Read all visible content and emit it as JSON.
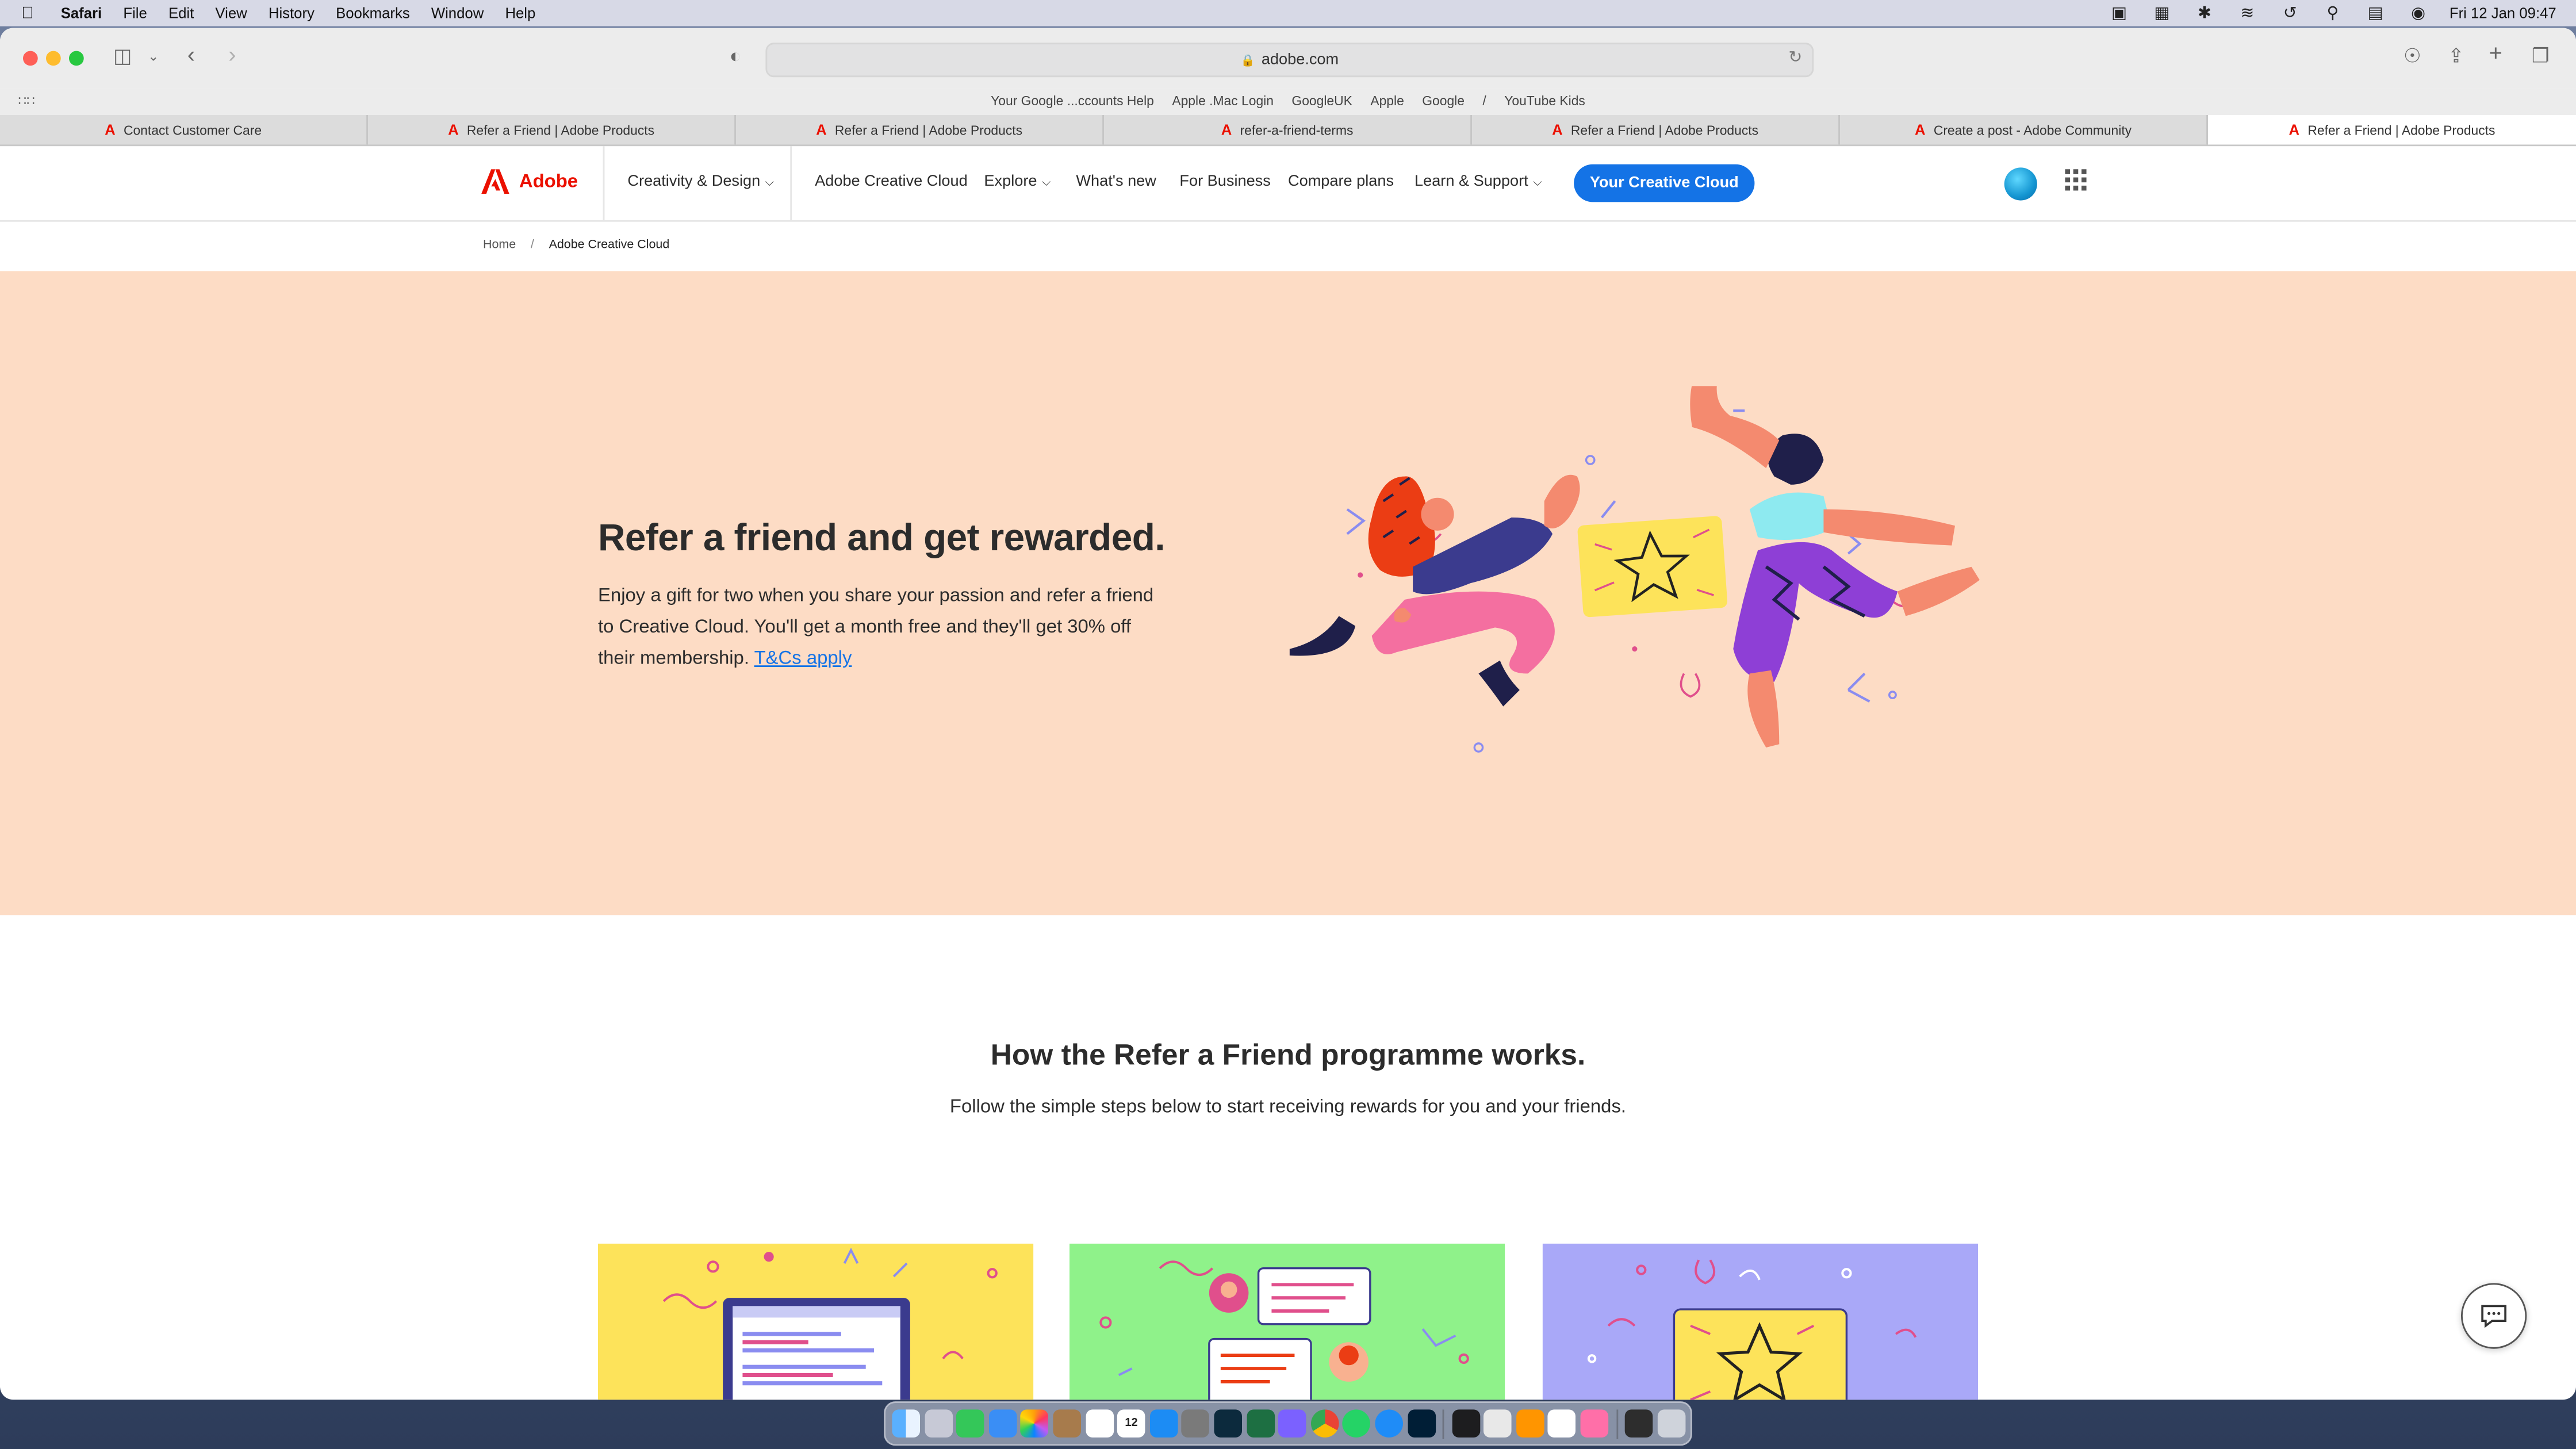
{
  "menubar": {
    "items": [
      "Safari",
      "File",
      "Edit",
      "View",
      "History",
      "Bookmarks",
      "Window",
      "Help"
    ],
    "status_icons": [
      "display-icon",
      "control-center-icon",
      "bluetooth-icon",
      "wifi-icon",
      "time-machine-icon",
      "spotlight-icon",
      "control-switch-icon",
      "siri-icon"
    ],
    "clock": "Fri 12 Jan  09:47"
  },
  "browser": {
    "url": "adobe.com",
    "favorites": [
      "Your Google ...ccounts Help",
      "Apple .Mac Login",
      "GoogleUK",
      "Apple",
      "Google",
      "/",
      "YouTube Kids"
    ],
    "tabs": [
      {
        "label": "Contact Customer Care"
      },
      {
        "label": "Refer a Friend | Adobe Products"
      },
      {
        "label": "Refer a Friend | Adobe Products"
      },
      {
        "label": "refer-a-friend-terms"
      },
      {
        "label": "Refer a Friend | Adobe Products"
      },
      {
        "label": "Create a post - Adobe Community"
      },
      {
        "label": "Refer a Friend | Adobe Products"
      }
    ]
  },
  "nav": {
    "brand": "Adobe",
    "creativity": "Creativity & Design",
    "acc": "Adobe Creative Cloud",
    "explore": "Explore",
    "whats_new": "What's new",
    "business": "For Business",
    "compare": "Compare plans",
    "learn": "Learn & Support",
    "cta": "Your Creative Cloud"
  },
  "breadcrumb": {
    "home": "Home",
    "sep": "/",
    "current": "Adobe Creative Cloud"
  },
  "hero": {
    "title": "Refer a friend and get rewarded.",
    "body": "Enjoy a gift for two when you share your passion and refer a friend to Creative Cloud. You'll get a month free and they'll get 30% off their membership.",
    "link": "T&Cs apply"
  },
  "how": {
    "title": "How the Refer a Friend programme works.",
    "subtitle": "Follow the simple steps below to start receiving rewards for you and your friends."
  },
  "colors": {
    "hero_bg": "#fddcc5",
    "accent": "#1473e6",
    "brand": "#eb1000",
    "card1": "#fde35a",
    "card2": "#8ff28a",
    "card3": "#a9a8f8"
  },
  "dock": [
    "Finder",
    "Launchpad",
    "Messages",
    "Mail",
    "Photos",
    "Notes",
    "Calendar",
    "App Store",
    "Lightroom Classic",
    "Excel",
    "Messenger",
    "Chrome",
    "WhatsApp",
    "Safari",
    "Photoshop",
    "Terminal",
    "Script Editor",
    "Books",
    "Word",
    "Klokki",
    "Screenshot",
    "Trash"
  ],
  "calendar_day": "12"
}
